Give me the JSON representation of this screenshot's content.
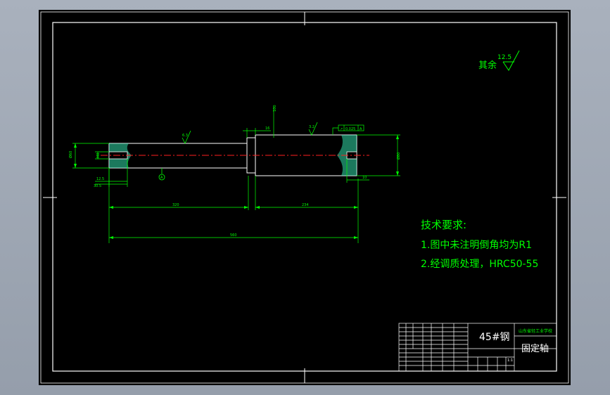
{
  "drawing": {
    "roughness_note": {
      "text": "其余",
      "value": "12.5"
    },
    "tech_requirements": {
      "title": "技术要求:",
      "items": [
        "1.图中未注明倒角均为R1",
        "2.经调质处理，HRC50-55"
      ]
    },
    "dimensions": {
      "left_segment_length": "320",
      "right_segment_length": "234",
      "overall_length": "560",
      "left_diameter": "Ø60",
      "left_bore": "M8",
      "left_thread_depth": "12.5",
      "left_bore_depth": "30.5",
      "right_diameter": "Ø80",
      "right_thread_depth": "10",
      "collar_width": "16",
      "collar_height": "100",
      "surface_roughness_left": "6.3",
      "surface_roughness_right": "3.2",
      "tolerance_value": "0.025",
      "datum": "A"
    },
    "title_block": {
      "material": "45#钢",
      "organization": "山东省轻工业学校",
      "part_name": "固定轴",
      "scale": "1:1"
    }
  },
  "colors": {
    "sheet": "#000000",
    "frame": "#ffffff",
    "geometry": "#ffffff",
    "dimension": "#00ff00",
    "annotation": "#00ff00",
    "centerline": "#ff2020",
    "section_fill": "#33ddaa",
    "title_text": "#ffffff"
  }
}
